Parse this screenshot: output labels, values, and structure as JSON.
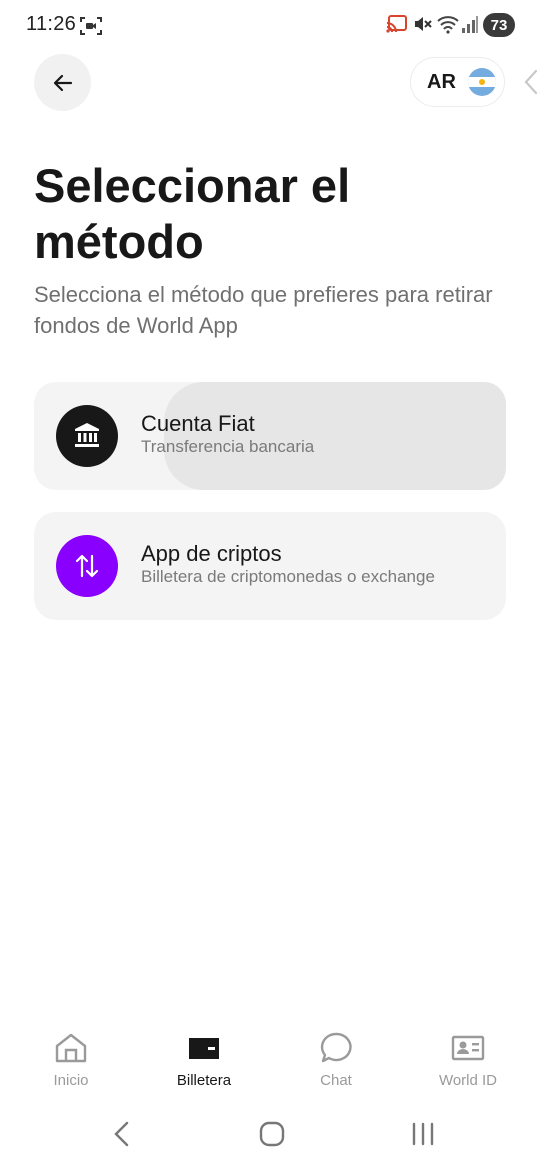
{
  "status_bar": {
    "time": "11:26",
    "battery": "73"
  },
  "header": {
    "country_code": "AR"
  },
  "title": "Seleccionar el método",
  "subtitle": "Selecciona el método que prefieres para retirar fondos de World App",
  "methods": [
    {
      "title": "Cuenta Fiat",
      "description": "Transferencia bancaria",
      "icon": "bank-icon",
      "icon_color": "#181818"
    },
    {
      "title": "App de criptos",
      "description": "Billetera de criptomonedas o exchange",
      "icon": "swap-arrows-icon",
      "icon_color": "#8a00ff"
    }
  ],
  "bottom_nav": [
    {
      "label": "Inicio",
      "icon": "home-icon",
      "active": false
    },
    {
      "label": "Billetera",
      "icon": "wallet-icon",
      "active": true
    },
    {
      "label": "Chat",
      "icon": "chat-icon",
      "active": false
    },
    {
      "label": "World ID",
      "icon": "id-card-icon",
      "active": false
    }
  ],
  "colors": {
    "accent_purple": "#8a00ff",
    "card_background": "#f4f4f4",
    "text_primary": "#181818",
    "text_secondary": "#707070"
  }
}
